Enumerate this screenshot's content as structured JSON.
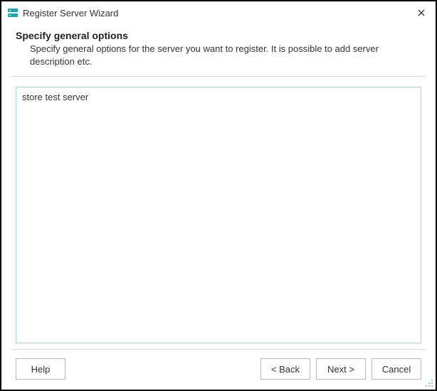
{
  "window": {
    "title": "Register Server Wizard"
  },
  "header": {
    "heading": "Specify general options",
    "subheading": "Specify general options for the server you want to register. It is possible to add server description etc."
  },
  "content": {
    "description_value": "store test server"
  },
  "footer": {
    "help_label": "Help",
    "back_label": "< Back",
    "next_label": "Next >",
    "cancel_label": "Cancel"
  },
  "icons": {
    "app_icon_color": "#1aa6b7"
  }
}
